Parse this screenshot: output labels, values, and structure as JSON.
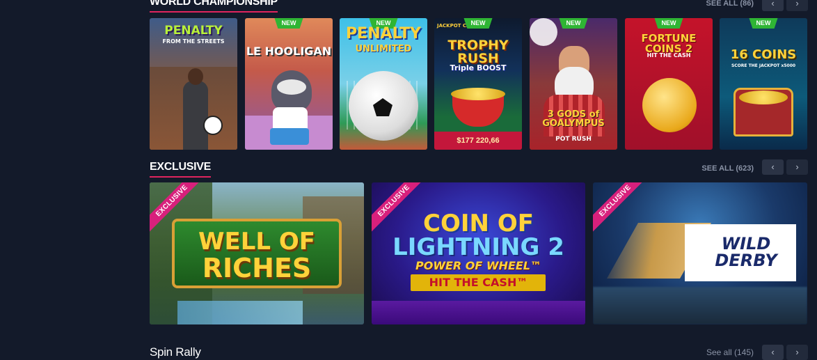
{
  "sections": {
    "world": {
      "title": "WORLD CHAMPIONSHIP",
      "see_all": "SEE ALL (86)",
      "prev_icon": "‹",
      "next_icon": "›"
    },
    "exclusive": {
      "title": "EXCLUSIVE",
      "see_all": "SEE ALL (623)",
      "prev_icon": "‹",
      "next_icon": "›"
    },
    "spin": {
      "title": "Spin Rally",
      "see_all": "See all (145)",
      "prev_icon": "‹",
      "next_icon": "›"
    }
  },
  "world_games": [
    {
      "title": "PENALTY",
      "subtitle": "FROM THE STREETS",
      "badge": ""
    },
    {
      "title": "LE HOOLIGAN",
      "badge": "NEW"
    },
    {
      "title": "PENALTY",
      "subtitle": "UNLIMITED",
      "badge": "NEW"
    },
    {
      "title": "TROPHY RUSH",
      "subtitle": "Triple BOOST",
      "top_label": "JACKPOT CARDS",
      "badge": "NEW",
      "jackpot": "$177 220,66"
    },
    {
      "title": "3 GODS of GOALYMPUS",
      "subtitle": "POT RUSH",
      "badge": "NEW"
    },
    {
      "title": "FORTUNE COINS 2",
      "subtitle": "HIT THE CASH",
      "badge": "NEW"
    },
    {
      "title": "16 COINS",
      "subtitle": "SCORE THE JACKPOT x5000",
      "badge": "NEW"
    }
  ],
  "exclusive_games": [
    {
      "badge": "EXCLUSIVE",
      "title_line1": "WELL OF",
      "title_line2": "RICHES"
    },
    {
      "badge": "EXCLUSIVE",
      "title_line1": "COIN OF",
      "title_line2": "LIGHTNING 2",
      "line3": "POWER OF WHEEL™",
      "line4": "HIT THE CASH™"
    },
    {
      "badge": "EXCLUSIVE",
      "title_line1": "WILD",
      "title_line2": "DERBY"
    }
  ],
  "colors": {
    "background": "#131a2a",
    "accent_underline": "#e0245e",
    "new_badge": "#2fb534",
    "exclusive_badge": "#d8207c",
    "jackpot_bar": "#c3173b"
  }
}
